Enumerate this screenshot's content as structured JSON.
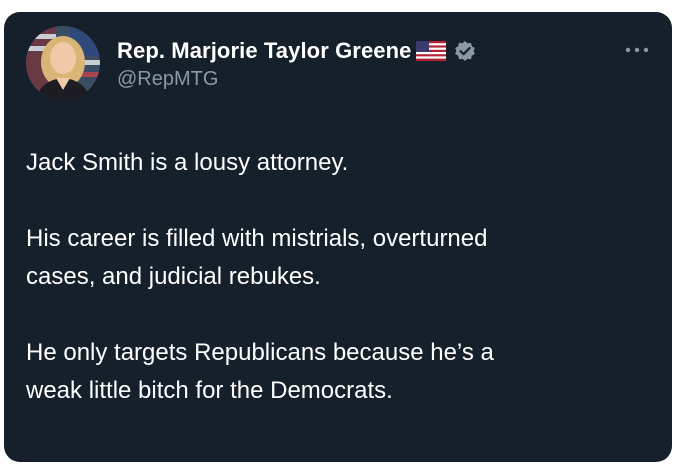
{
  "post": {
    "author": {
      "display_name": "Rep. Marjorie Taylor Greene",
      "handle": "@RepMTG",
      "avatar_icon": "profile-photo",
      "badges": [
        "us-flag-icon",
        "verified-badge-icon"
      ],
      "badge_color": "#8b98a5"
    },
    "menu_icon": "more-options-icon",
    "paragraphs": [
      "Jack Smith is a lousy attorney.",
      "His career is filled with mistrials, overturned\ncases, and judicial rebukes.",
      "He only targets Republicans because he’s a\nweak little bitch for the Democrats."
    ]
  },
  "theme": {
    "card_background": "#15202b",
    "text_primary": "#ffffff",
    "text_secondary": "#8b98a5"
  }
}
